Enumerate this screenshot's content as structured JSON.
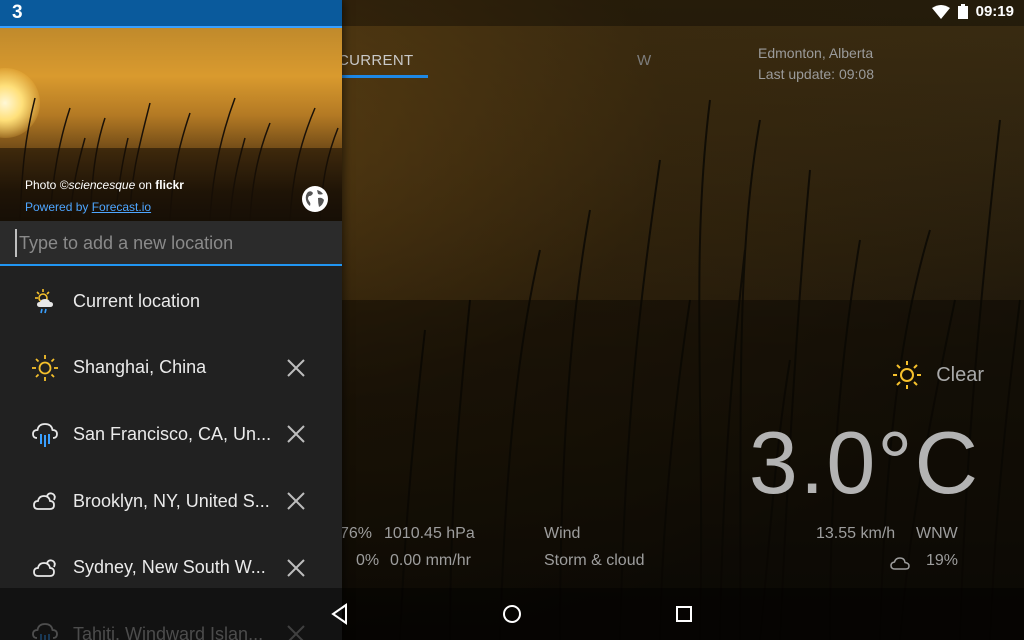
{
  "status": {
    "time": "09:19"
  },
  "drawer": {
    "badge": "3",
    "photo_prefix": "Photo ©",
    "photo_author": "sciencesque",
    "photo_on": " on ",
    "photo_site": "flickr",
    "powered_prefix": "Powered by ",
    "powered_link": "Forecast.io",
    "add_placeholder": "Type to add a new location",
    "locations": [
      {
        "label": "Current location",
        "icon": "partly-sunny-rain-icon",
        "removable": false
      },
      {
        "label": "Shanghai, China",
        "icon": "sun-icon",
        "removable": true
      },
      {
        "label": "San Francisco, CA, Un...",
        "icon": "rain-icon",
        "removable": true
      },
      {
        "label": "Brooklyn, NY, United S...",
        "icon": "cloud-sun-icon",
        "removable": true
      },
      {
        "label": "Sydney, New South W...",
        "icon": "cloud-sun-icon",
        "removable": true
      },
      {
        "label": "Tahiti, Windward Islan...",
        "icon": "rain-icon",
        "removable": true
      }
    ]
  },
  "main": {
    "tabs": [
      {
        "label": "CURRENT",
        "active": true
      },
      {
        "label": "W",
        "active": false
      }
    ],
    "location": "Edmonton, Alberta",
    "last_update": "Last update: 09:08",
    "condition": "Clear",
    "condition_icon": "sun-icon",
    "temperature": "3.0°C",
    "stats": {
      "humidity": "76%",
      "pressure": "1010.45 hPa",
      "wind_label": "Wind",
      "wind_speed": "13.55 km/h",
      "wind_dir": "WNW",
      "precip_prob": "0%",
      "precip_rate": "0.00 mm/hr",
      "storm_label": "Storm & cloud",
      "cloud_icon": "cloud-icon",
      "cloud_cover": "19%"
    }
  },
  "colors": {
    "accent": "#2196f3",
    "drawer_bg": "#212121",
    "status_blue": "#0a5a9c",
    "sun_yellow": "#f6c12c"
  }
}
